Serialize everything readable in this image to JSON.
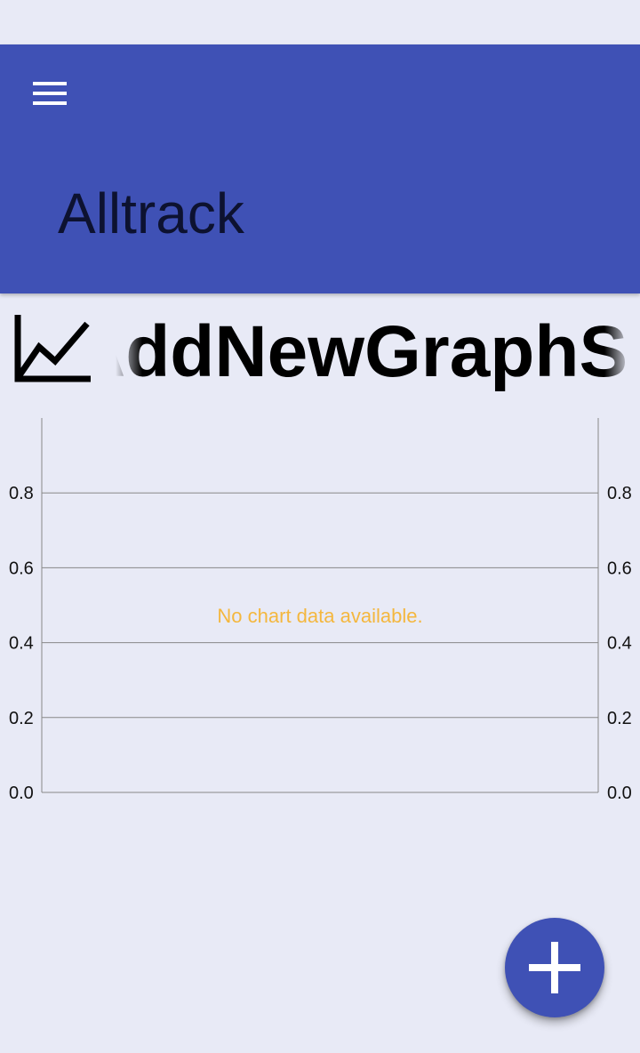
{
  "app_bar": {
    "title": "Alltrack",
    "menu_icon": "hamburger-menu-icon",
    "color": "#3f51b5"
  },
  "graph": {
    "icon": "line-chart-icon",
    "title": "AddNewGraphShould"
  },
  "chart_data": {
    "type": "line",
    "title": "",
    "xlabel": "",
    "ylabel": "",
    "ylim": [
      0,
      1
    ],
    "y_ticks_left": [
      "0.0",
      "0.2",
      "0.4",
      "0.6",
      "0.8"
    ],
    "y_ticks_right": [
      "0.0",
      "0.2",
      "0.4",
      "0.6",
      "0.8"
    ],
    "y_tick_values": [
      0,
      0.2,
      0.4,
      0.6,
      0.8
    ],
    "grid": true,
    "series": [],
    "empty_message": "No chart data available.",
    "empty_message_color": "#f4b73e"
  },
  "fab": {
    "icon": "plus-icon",
    "color": "#3f51b5"
  }
}
